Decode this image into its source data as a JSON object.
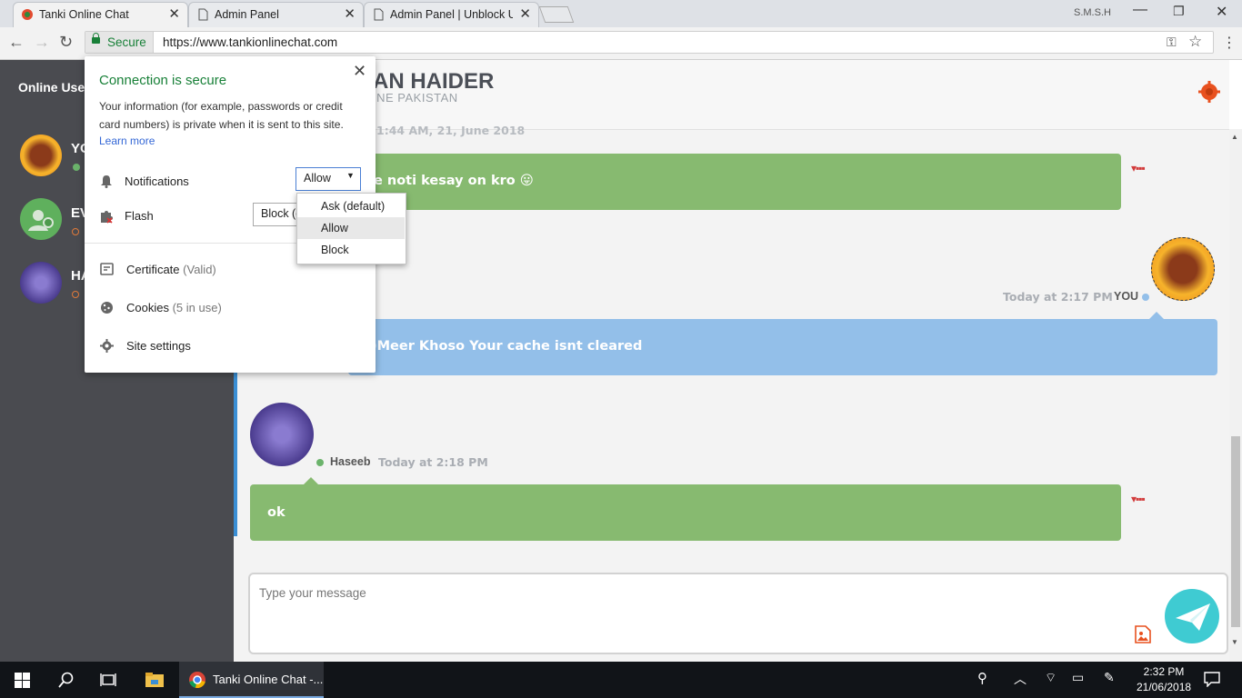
{
  "browser": {
    "tabs": [
      {
        "title": "Tanki Online Chat",
        "active": true
      },
      {
        "title": "Admin Panel",
        "active": false
      },
      {
        "title": "Admin Panel | Unblock U",
        "active": false
      }
    ],
    "profile": "S.M.S.H",
    "security_label": "Secure",
    "url": "https://www.tankionlinechat.com"
  },
  "sidebar": {
    "title": "Online User",
    "users": [
      {
        "name": "YO"
      },
      {
        "name": "EV"
      },
      {
        "name": "HA"
      }
    ]
  },
  "header": {
    "name": "AN HAIDER",
    "subtitle": "INE PAKISTAN"
  },
  "messages": [
    {
      "timestamp": "1:44 AM, 21, June 2018",
      "text": "e noti kesay on kro 😛"
    },
    {
      "sender": "YOU",
      "time": "Today at 2:17 PM",
      "text": ")Meer Khoso Your cache isnt cleared"
    },
    {
      "sender": "Haseeb",
      "time": "Today at 2:18 PM",
      "text": "ok"
    }
  ],
  "message_dots": "▾▪▪▪",
  "composer": {
    "placeholder": "Type your message"
  },
  "site_info_popup": {
    "title": "Connection is secure",
    "description": "Your information (for example, passwords or credit card numbers) is private when it is sent to this site.",
    "learn_more": "Learn more",
    "notifications_label": "Notifications",
    "notifications_value": "Allow",
    "flash_label": "Flash",
    "flash_value": "Block (d",
    "certificate_label": "Certificate",
    "certificate_status": "(Valid)",
    "cookies_label": "Cookies",
    "cookies_status": "(5 in use)",
    "site_settings_label": "Site settings",
    "dropdown_options": [
      "Ask (default)",
      "Allow",
      "Block"
    ],
    "dropdown_highlighted": "Allow"
  },
  "taskbar": {
    "app_title": "Tanki Online Chat -...",
    "time": "2:32 PM",
    "date": "21/06/2018"
  },
  "colors": {
    "green_bubble": "#87ba70",
    "blue_bubble": "#93bfe9",
    "sidebar": "#4a4b50",
    "secure_green": "#188038"
  }
}
